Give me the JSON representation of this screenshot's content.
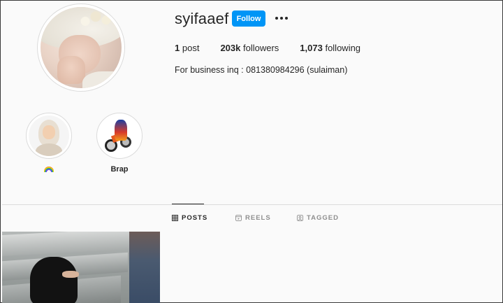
{
  "profile": {
    "username": "syifaaef",
    "follow_label": "Follow",
    "stats": {
      "posts_count": "1",
      "posts_label": "post",
      "followers_count": "203k",
      "followers_label": "followers",
      "following_count": "1,073",
      "following_label": "following"
    },
    "bio": "For business inq : 081380984296 (sulaiman)"
  },
  "highlights": [
    {
      "label": "🌈",
      "icon": "rainbow-icon"
    },
    {
      "label": "Brap",
      "icon": "motorbike-image"
    }
  ],
  "tabs": [
    {
      "label": "POSTS",
      "icon": "grid-icon",
      "active": true
    },
    {
      "label": "REELS",
      "icon": "reels-icon",
      "active": false
    },
    {
      "label": "TAGGED",
      "icon": "tagged-icon",
      "active": false
    }
  ],
  "colors": {
    "follow_button": "#0095f6",
    "background": "#fafafa",
    "text": "#262626",
    "muted": "#8e8e8e"
  }
}
